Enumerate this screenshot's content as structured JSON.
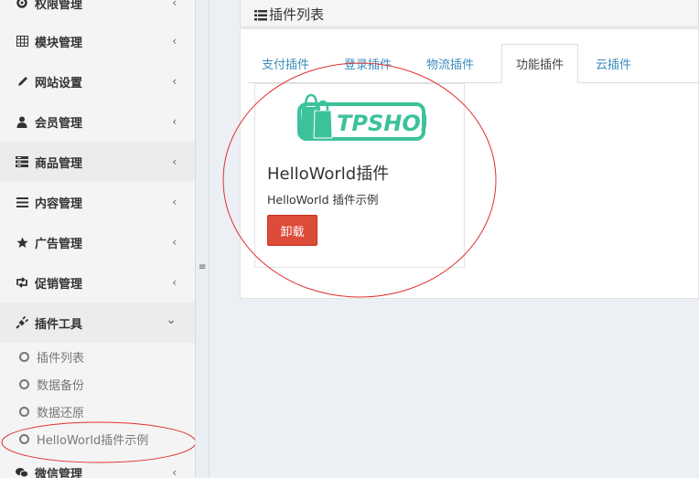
{
  "sidebar": {
    "items": [
      {
        "label": "权限管理",
        "icon": "gear-icon",
        "arrow": "‹"
      },
      {
        "label": "模块管理",
        "icon": "grid-icon",
        "arrow": "‹"
      },
      {
        "label": "网站设置",
        "icon": "pencil-icon",
        "arrow": "‹"
      },
      {
        "label": "会员管理",
        "icon": "user-icon",
        "arrow": "‹"
      },
      {
        "label": "商品管理",
        "icon": "list-icon",
        "arrow": "‹"
      },
      {
        "label": "内容管理",
        "icon": "bars-icon",
        "arrow": "‹"
      },
      {
        "label": "广告管理",
        "icon": "star-icon",
        "arrow": "‹"
      },
      {
        "label": "促销管理",
        "icon": "retweet-icon",
        "arrow": "‹"
      },
      {
        "label": "插件工具",
        "icon": "plug-icon",
        "arrow": "⌄"
      },
      {
        "label": "微信管理",
        "icon": "wechat-icon",
        "arrow": "‹"
      }
    ],
    "subitems": [
      {
        "label": "插件列表"
      },
      {
        "label": "数据备份"
      },
      {
        "label": "数据还原"
      },
      {
        "label": "HelloWorld插件示例"
      }
    ]
  },
  "splitter": {
    "grip": "≡"
  },
  "panel": {
    "title": "插件列表",
    "tabs": [
      {
        "label": "支付插件"
      },
      {
        "label": "登录插件"
      },
      {
        "label": "物流插件"
      },
      {
        "label": "功能插件"
      },
      {
        "label": "云插件"
      }
    ],
    "active_tab": "功能插件"
  },
  "plugin": {
    "logo_text": "TPSHOP",
    "name": "HelloWorld插件",
    "description": "HelloWorld 插件示例",
    "uninstall_label": "卸载"
  },
  "colors": {
    "link": "#3c8dbc",
    "danger": "#dd4b39",
    "logo": "#3cc29b",
    "annotation": "#e03030"
  }
}
